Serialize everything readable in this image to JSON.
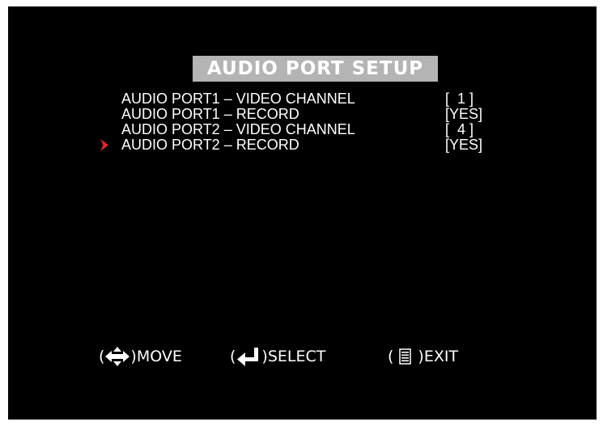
{
  "title": "AUDIO PORT SETUP",
  "selected_index": 3,
  "colors": {
    "background": "#000000",
    "title_bar": "#b4b4b4",
    "text": "#ffffff",
    "cursor": "#e8262a"
  },
  "menu": [
    {
      "label": "AUDIO PORT1 – VIDEO CHANNEL",
      "value": "[  1 ]"
    },
    {
      "label": "AUDIO PORT1 – RECORD",
      "value": "[YES]"
    },
    {
      "label": "AUDIO PORT2 – VIDEO CHANNEL",
      "value": "[  4 ]"
    },
    {
      "label": "AUDIO PORT2 – RECORD",
      "value": "[YES]"
    }
  ],
  "footer": {
    "move": {
      "open": "(",
      "icon": "four-way-arrow-icon",
      "close": ")",
      "label": "MOVE"
    },
    "select": {
      "open": "(",
      "icon": "enter-key-icon",
      "close": ")",
      "label": "SELECT"
    },
    "exit": {
      "open": "(",
      "icon": "menu-lines-icon",
      "close": ")",
      "label": "EXIT"
    }
  }
}
